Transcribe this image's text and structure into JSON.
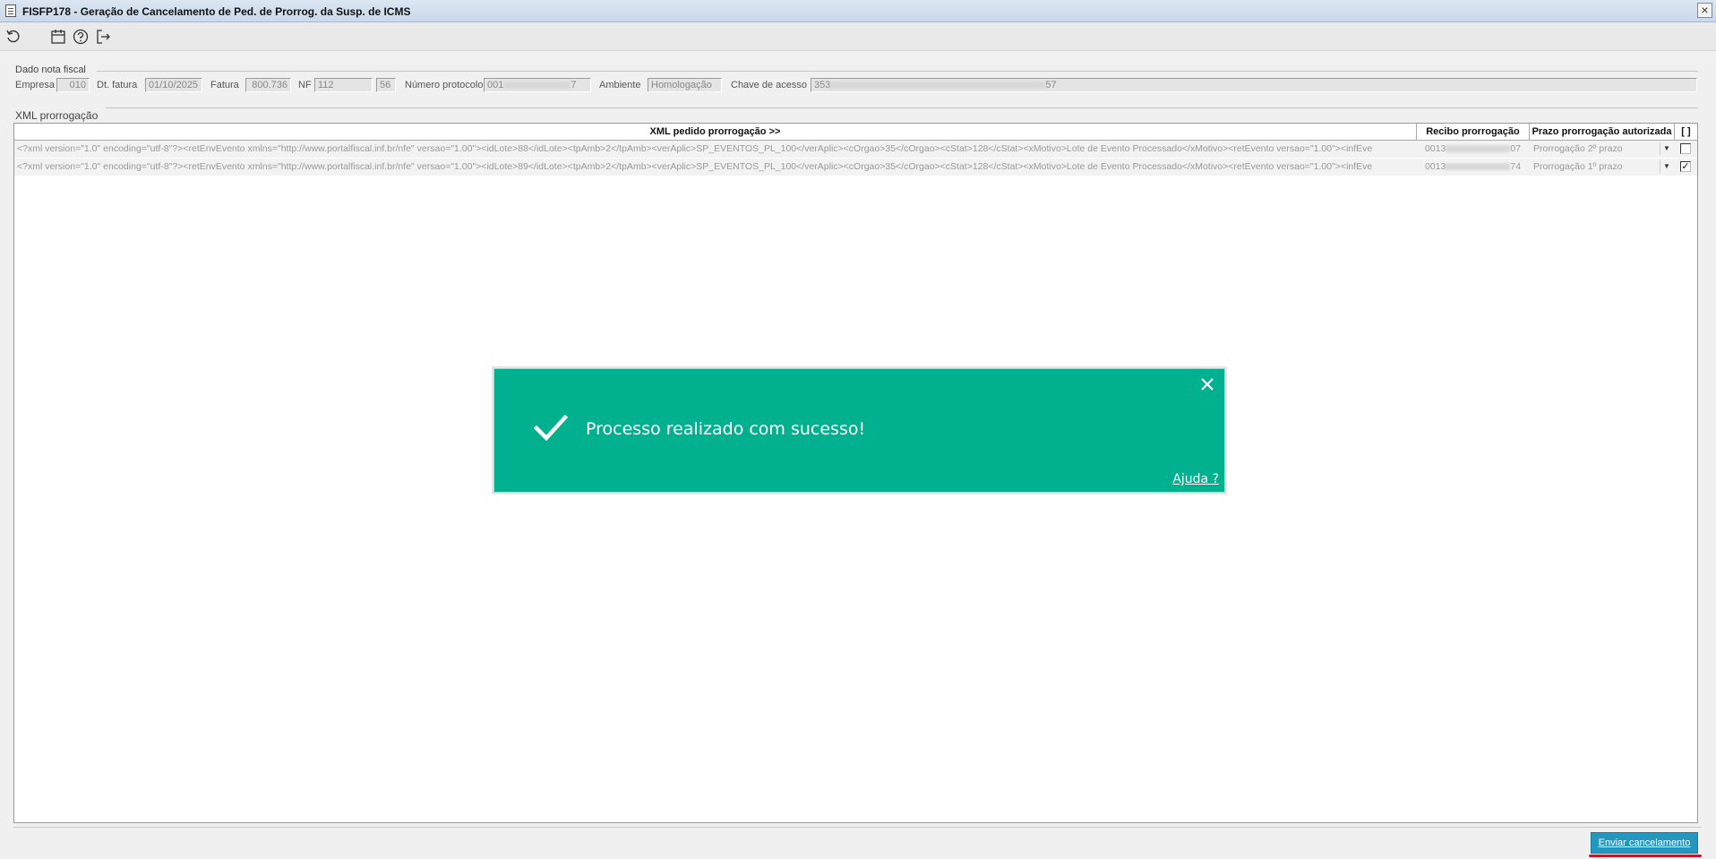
{
  "window": {
    "title": "FISFP178 - Geração de Cancelamento de Ped. de Prorrog. da Susp. de ICMS",
    "close_glyph": "×"
  },
  "toolbar": {
    "icons": [
      "refresh-icon",
      "calendar-icon",
      "help-icon",
      "exit-icon"
    ]
  },
  "fiscal": {
    "section_title": "Dado nota fiscal",
    "empresa_label": "Empresa",
    "empresa": "010",
    "dt_fatura_label": "Dt. fatura",
    "dt_fatura": "01/10/2025",
    "fatura_label": "Fatura",
    "fatura": "800.736",
    "nf_label": "NF",
    "nf": "112",
    "serie": "56",
    "protocolo_label": "Número protocolo",
    "protocolo_start": "001",
    "protocolo_end": "7",
    "ambiente_label": "Ambiente",
    "ambiente": "Homologação",
    "chave_label": "Chave de acesso",
    "chave_start": "353",
    "chave_end": "57"
  },
  "xml": {
    "section_title": "XML prorrogação",
    "columns": {
      "xml": "XML pedido prorrogação >>",
      "recibo": "Recibo prorrogação",
      "prazo": "Prazo prorrogação autorizada",
      "check": "[ ]"
    },
    "rows": [
      {
        "xml": "<?xml version=\"1.0\" encoding=\"utf-8\"?><retEnvEvento xmlns=\"http://www.portalfiscal.inf.br/nfe\" versao=\"1.00\"><idLote>88</idLote><tpAmb>2</tpAmb><verAplic>SP_EVENTOS_PL_100</verAplic><cOrgao>35</cOrgao><cStat>128</cStat><xMotivo>Lote de Evento Processado</xMotivo><retEvento versao=\"1.00\"><infEve",
        "recibo_start": "0013",
        "recibo_end": "07",
        "prazo": "Prorrogação 2º prazo",
        "checked_glyph": ""
      },
      {
        "xml": "<?xml version=\"1.0\" encoding=\"utf-8\"?><retEnvEvento xmlns=\"http://www.portalfiscal.inf.br/nfe\" versao=\"1.00\"><idLote>89</idLote><tpAmb>2</tpAmb><verAplic>SP_EVENTOS_PL_100</verAplic><cOrgao>35</cOrgao><cStat>128</cStat><xMotivo>Lote de Evento Processado</xMotivo><retEvento versao=\"1.00\"><infEve",
        "recibo_start": "0013",
        "recibo_end": "74",
        "prazo": "Prorrogação 1º prazo",
        "checked_glyph": "✓"
      }
    ]
  },
  "dialog": {
    "message": "Processo realizado com sucesso!",
    "help_link": "Ajuda ?",
    "background": "#00b08f"
  },
  "footer": {
    "send_label": "Enviar cancelamento",
    "button_color": "#2497c0"
  }
}
